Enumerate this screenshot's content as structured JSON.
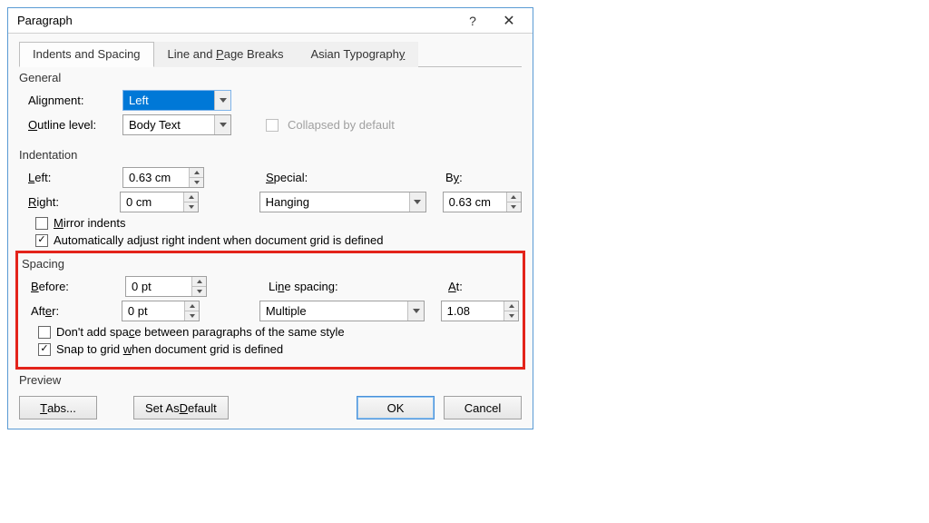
{
  "title": "Paragraph",
  "tabs": {
    "t1": "Indents and Spacing",
    "t2_pre": "Line and ",
    "t2_u": "P",
    "t2_post": "age Breaks",
    "t3_pre": "Asian Typograph",
    "t3_u": "y",
    "t3_post": ""
  },
  "general": {
    "header": "General",
    "alignment_pre": "Ali",
    "alignment_u": "g",
    "alignment_post": "nment:",
    "alignment_value": "Left",
    "outline_u": "O",
    "outline_post": "utline level:",
    "outline_value": "Body Text",
    "collapsed_label": "Collapsed by default"
  },
  "indent": {
    "header": "Indentation",
    "left_u": "L",
    "left_post": "eft:",
    "left_value": "0.63 cm",
    "right_u": "R",
    "right_post": "ight:",
    "right_value": "0 cm",
    "special_u": "S",
    "special_post": "pecial:",
    "special_value": "Hanging",
    "by_pre": "B",
    "by_u": "y",
    "by_post": ":",
    "by_value": "0.63 cm",
    "mirror_u": "M",
    "mirror_post": "irror indents",
    "auto_pre": "Automatically ad",
    "auto_u": "j",
    "auto_post": "ust right indent when document grid is defined"
  },
  "spacing": {
    "header": "Spacing",
    "before_u": "B",
    "before_post": "efore:",
    "before_value": "0 pt",
    "after_pre": "Aft",
    "after_u": "e",
    "after_post": "r:",
    "after_value": "0 pt",
    "line_pre": "Li",
    "line_u": "n",
    "line_post": "e spacing:",
    "line_value": "Multiple",
    "at_u": "A",
    "at_post": "t:",
    "at_value": "1.08",
    "noadd_pre": "Don't add spa",
    "noadd_u": "c",
    "noadd_post": "e between paragraphs of the same style",
    "snap_pre": "Snap to grid ",
    "snap_u": "w",
    "snap_post": "hen document grid is defined"
  },
  "preview": "Preview",
  "buttons": {
    "tabs_u": "T",
    "tabs_post": "abs...",
    "default_pre": "Set As ",
    "default_u": "D",
    "default_post": "efault",
    "ok": "OK",
    "cancel": "Cancel"
  }
}
